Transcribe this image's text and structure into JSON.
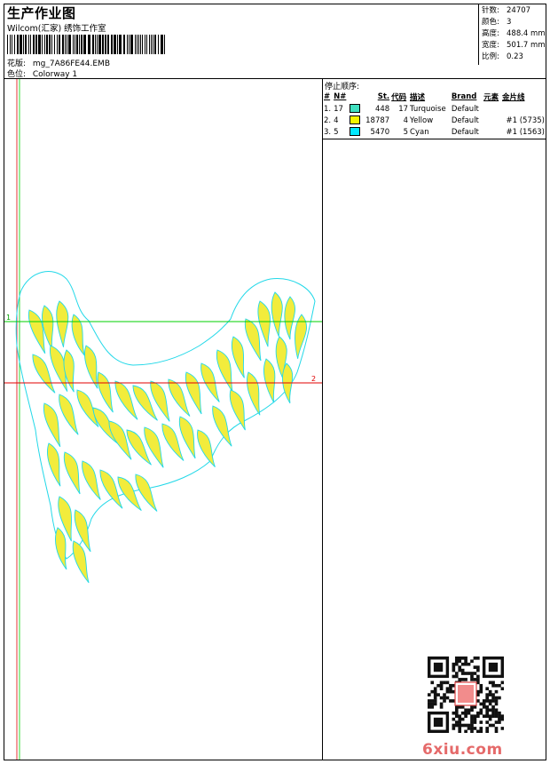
{
  "header": {
    "title": "生产作业图",
    "company": "Wilcom(汇家) 绣饰工作室",
    "design_label": "花版:",
    "design_file": "mg_7A86FE44.EMB",
    "colorway_label": "色位:",
    "colorway": "Colorway 1"
  },
  "stats": [
    {
      "label": "针数:",
      "value": "24707"
    },
    {
      "label": "颜色:",
      "value": "3"
    },
    {
      "label": "高度:",
      "value": "488.4 mm"
    },
    {
      "label": "宽度:",
      "value": "501.7 mm"
    },
    {
      "label": "比例:",
      "value": "0.23"
    }
  ],
  "sequence": {
    "title": "停止顺序:",
    "columns": {
      "num": "#",
      "code": "N#",
      "stitches": "St.",
      "code2": "代码",
      "desc": "描述",
      "brand": "Brand",
      "element": "元素",
      "thread": "金片线"
    },
    "rows": [
      {
        "num": "1.",
        "code": "17",
        "color": "#40e0c0",
        "stitches": "448",
        "code2": "17",
        "desc": "Turquoise",
        "brand": "Default",
        "thread": ""
      },
      {
        "num": "2.",
        "code": "4",
        "color": "#f5f500",
        "stitches": "18787",
        "code2": "4",
        "desc": "Yellow",
        "brand": "Default",
        "thread": "#1 (5735)"
      },
      {
        "num": "3.",
        "code": "5",
        "color": "#00e8ff",
        "stitches": "5470",
        "code2": "5",
        "desc": "Cyan",
        "brand": "Default",
        "thread": "#1 (1563)"
      }
    ]
  },
  "guides": {
    "line1": "1",
    "line2": "2"
  },
  "watermark": "6xiu.com",
  "colors": {
    "fill": "#f2ec3c",
    "outline": "#22d8e8",
    "guide_green": "#00d000",
    "guide_red": "#e00000"
  }
}
